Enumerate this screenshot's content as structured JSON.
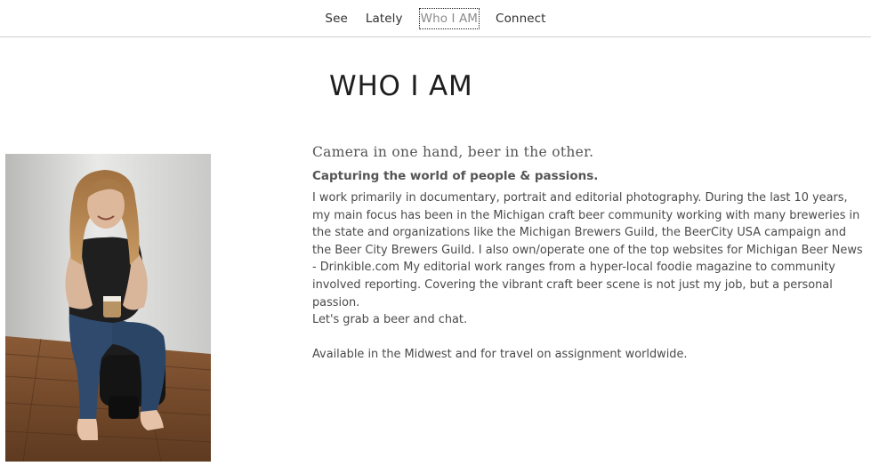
{
  "nav": {
    "items": [
      {
        "label": "See",
        "active": false
      },
      {
        "label": "Lately",
        "active": false
      },
      {
        "label": "Who I AM",
        "active": true
      },
      {
        "label": "Connect",
        "active": false
      }
    ]
  },
  "page": {
    "title": "WHO I AM"
  },
  "about": {
    "tagline": "Camera in one hand, beer in the other.",
    "subhead": "Capturing the world of people & passions.",
    "paragraph": "I work primarily in documentary, portrait and editorial photography. During the last 10 years, my main focus has been in the Michigan craft beer community working with many breweries in the state and organizations like the Michigan Brewers Guild, the BeerCity USA campaign and the Beer City Brewers Guild. I also own/operate one of the top websites for Michigan Beer News - Drinkible.com My editorial work ranges from a hyper-local foodie magazine to community involved reporting. Covering the vibrant craft beer scene is not just my job, but a personal passion.",
    "cta": "Let's grab a beer and chat.",
    "availability": "Available in the Midwest and for travel on assignment worldwide."
  },
  "colors": {
    "background": "#ffffff",
    "text": "#3a3a3a",
    "nav_border": "#cfcfcf",
    "active_nav": "#8c8c8c"
  }
}
